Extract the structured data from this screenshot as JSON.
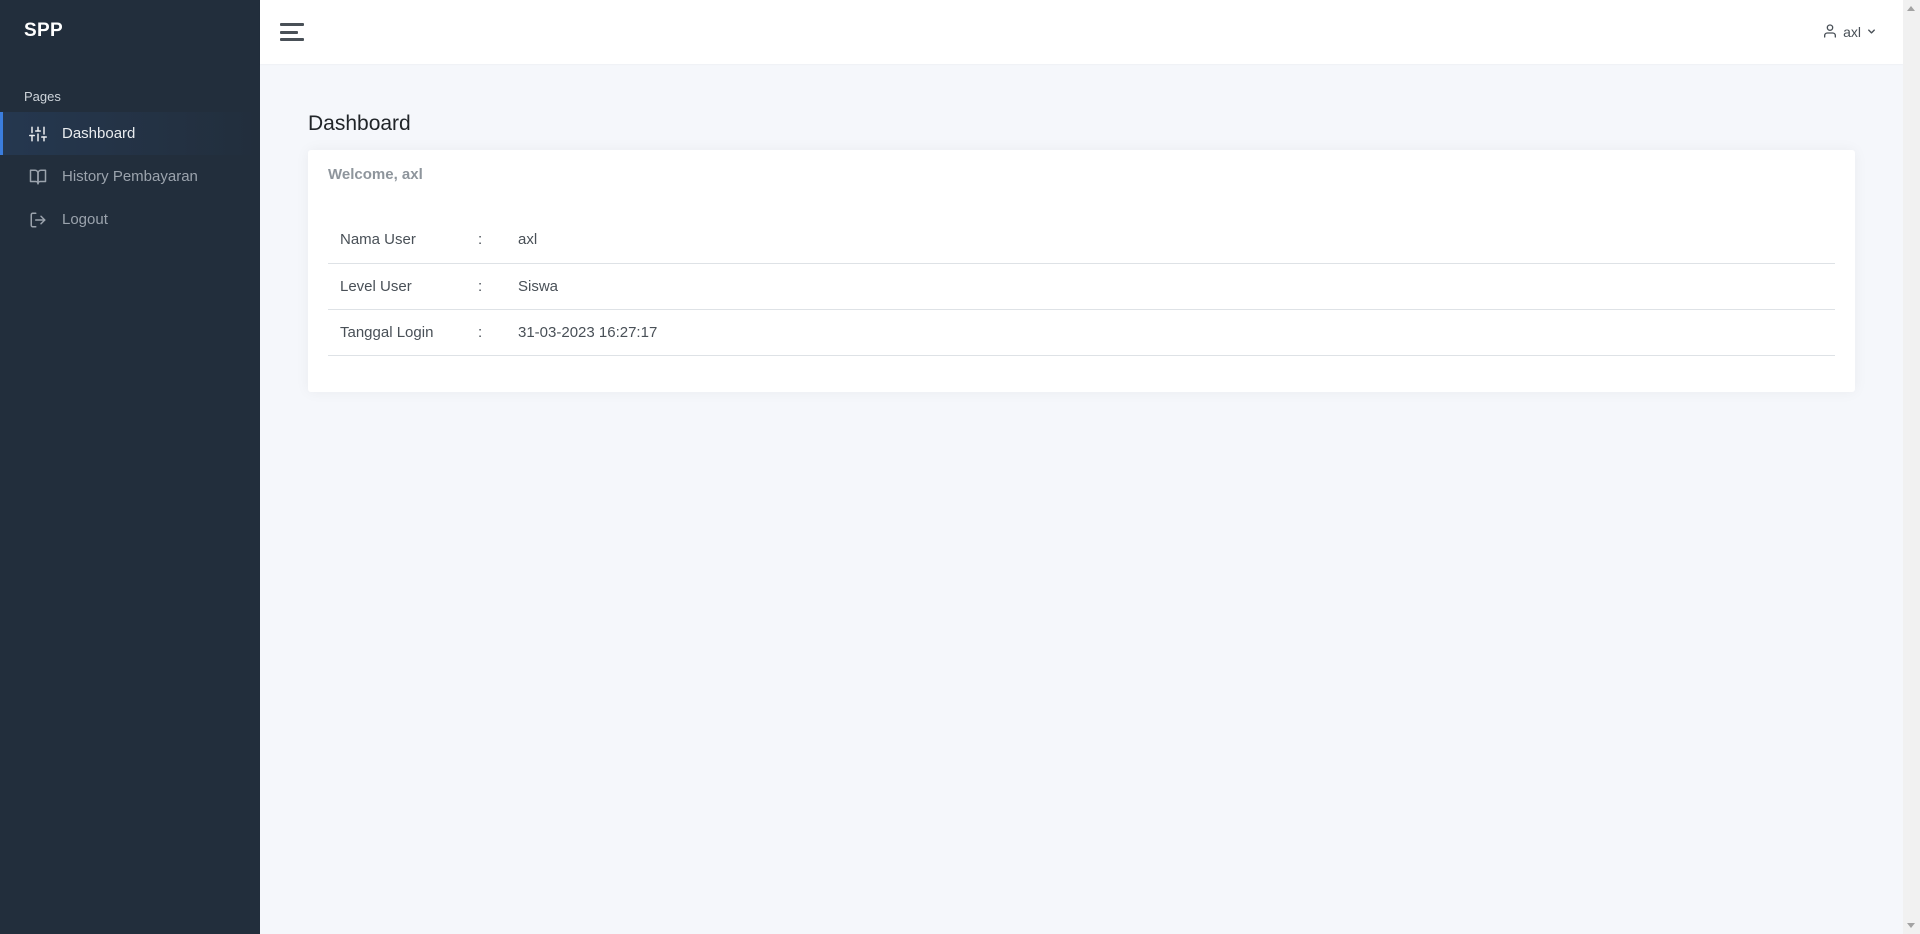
{
  "sidebar": {
    "brand": "SPP",
    "section_header": "Pages",
    "items": [
      {
        "label": "Dashboard",
        "icon": "sliders-icon",
        "active": true
      },
      {
        "label": "History Pembayaran",
        "icon": "book-icon",
        "active": false
      },
      {
        "label": "Logout",
        "icon": "logout-icon",
        "active": false
      }
    ]
  },
  "topbar": {
    "user_name": "axl"
  },
  "main": {
    "page_title": "Dashboard",
    "card": {
      "title": "Welcome, axl",
      "rows": [
        {
          "label": "Nama User",
          "colon": ":",
          "value": "axl"
        },
        {
          "label": "Level User",
          "colon": ":",
          "value": "Siswa"
        },
        {
          "label": "Tanggal Login",
          "colon": ":",
          "value": "31-03-2023 16:27:17"
        }
      ]
    }
  },
  "colors": {
    "sidebar_bg": "#222e3c",
    "accent": "#3b7ddd",
    "page_bg": "#f5f7fb"
  }
}
